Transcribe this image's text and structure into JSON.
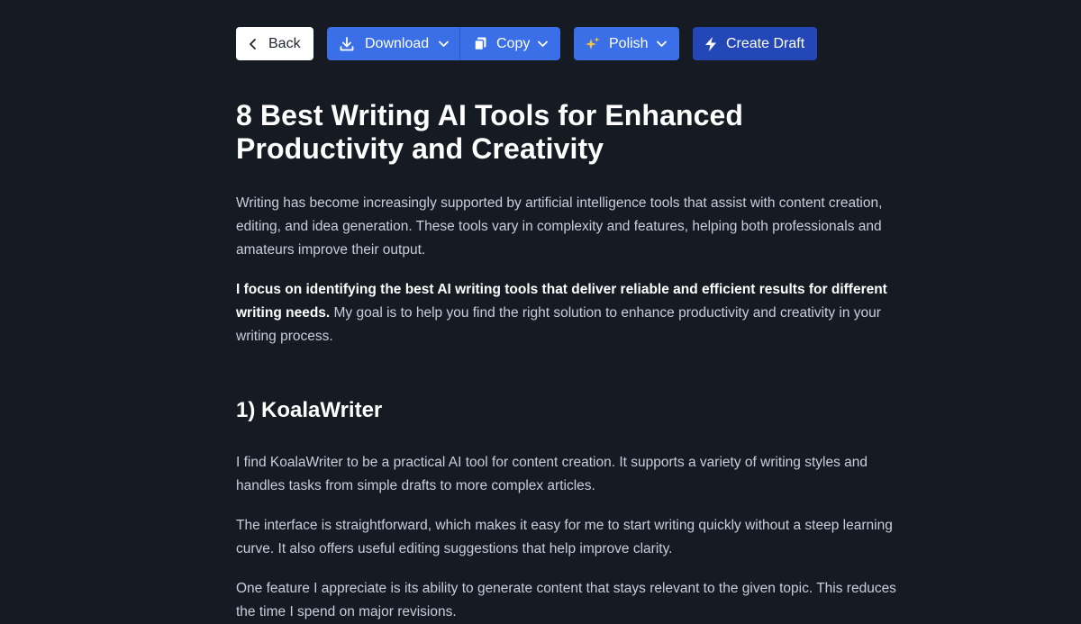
{
  "toolbar": {
    "back_label": "Back",
    "download_label": "Download",
    "copy_label": "Copy",
    "polish_label": "Polish",
    "create_draft_label": "Create Draft",
    "icons": {
      "back": "chevron-left-icon",
      "download": "download-icon",
      "copy": "copy-icon",
      "polish": "sparkles-icon",
      "create_draft": "lightning-bolt-icon",
      "dropdown": "chevron-down-icon"
    },
    "colors": {
      "primary": "#3a6fe8",
      "create_draft": "#2447b8",
      "sparkle": "#f5c542"
    }
  },
  "article": {
    "title": "8 Best Writing AI Tools for Enhanced Productivity and Creativity",
    "intro": "Writing has become increasingly supported by artificial intelligence tools that assist with content creation, editing, and idea generation. These tools vary in complexity and features, helping both professionals and amateurs improve their output.",
    "focus_bold": "I focus on identifying the best AI writing tools that deliver reliable and efficient results for different writing needs.",
    "focus_rest": " My goal is to help you find the right solution to enhance productivity and creativity in your writing process.",
    "section_heading": "1) KoalaWriter",
    "section_paragraphs": [
      "I find KoalaWriter to be a practical AI tool for content creation. It supports a variety of writing styles and handles tasks from simple drafts to more complex articles.",
      "The interface is straightforward, which makes it easy for me to start writing quickly without a steep learning curve. It also offers useful editing suggestions that help improve clarity.",
      "One feature I appreciate is its ability to generate content that stays relevant to the given topic. This reduces the time I spend on major revisions."
    ]
  },
  "colors": {
    "background": "#151a23",
    "body_text": "#c9ced8",
    "heading_text": "#ffffff"
  }
}
